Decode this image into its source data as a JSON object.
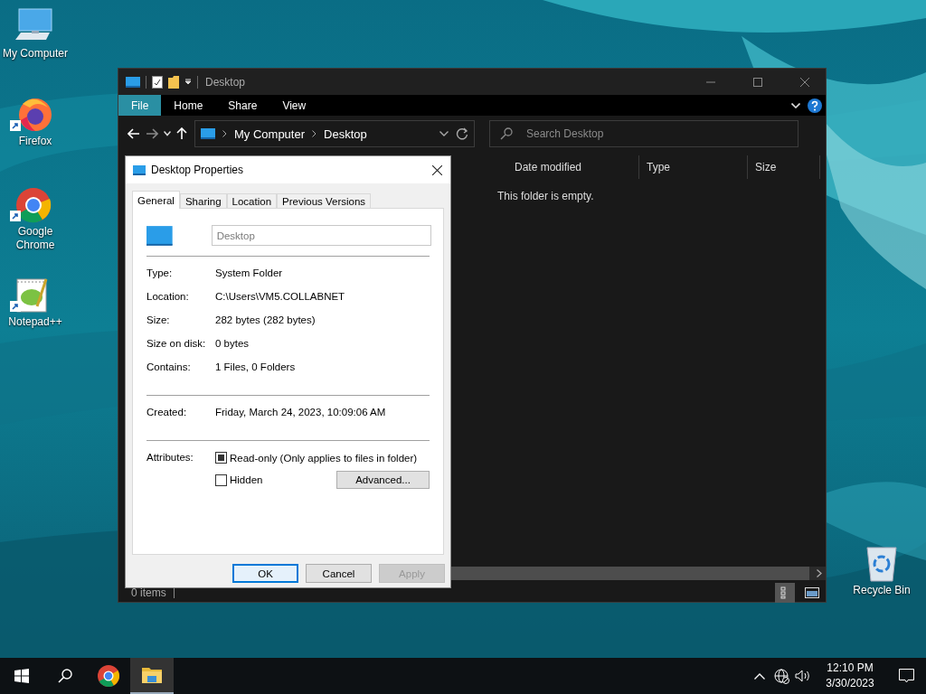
{
  "desktop_icons": [
    {
      "kind": "computer",
      "label": "My Computer",
      "shortcut": false
    },
    {
      "kind": "firefox",
      "label": "Firefox",
      "shortcut": true
    },
    {
      "kind": "chrome",
      "label": "Google Chrome",
      "shortcut": true
    },
    {
      "kind": "notepad",
      "label": "Notepad++",
      "shortcut": true
    }
  ],
  "recycle_bin": {
    "label": "Recycle Bin"
  },
  "explorer": {
    "title": "Desktop",
    "ribbon_tabs": [
      {
        "label": "File",
        "selected": true
      },
      {
        "label": "Home",
        "selected": false
      },
      {
        "label": "Share",
        "selected": false
      },
      {
        "label": "View",
        "selected": false
      }
    ],
    "breadcrumb": [
      "My Computer",
      "Desktop"
    ],
    "search": {
      "placeholder": "Search Desktop"
    },
    "columns": [
      "Date modified",
      "Type",
      "Size"
    ],
    "empty_message": "This folder is empty.",
    "status": "0 items"
  },
  "dialog": {
    "title": "Desktop Properties",
    "tabs": [
      {
        "label": "General",
        "selected": true
      },
      {
        "label": "Sharing",
        "selected": false
      },
      {
        "label": "Location",
        "selected": false
      },
      {
        "label": "Previous Versions",
        "selected": false
      }
    ],
    "name_field": {
      "value": "Desktop",
      "disabled": true
    },
    "info_groups": [
      [
        {
          "label": "Type:",
          "value": "System Folder"
        },
        {
          "label": "Location:",
          "value": "C:\\Users\\VM5.COLLABNET"
        },
        {
          "label": "Size:",
          "value": "282 bytes (282 bytes)"
        },
        {
          "label": "Size on disk:",
          "value": "0 bytes"
        },
        {
          "label": "Contains:",
          "value": "1 Files, 0 Folders"
        }
      ],
      [
        {
          "label": "Created:",
          "value": "Friday, March 24, 2023, 10:09:06 AM"
        }
      ]
    ],
    "attributes_label": "Attributes:",
    "attributes": [
      {
        "label": "Read-only (Only applies to files in folder)",
        "checked": false,
        "indeterminate": true
      },
      {
        "label": "Hidden",
        "checked": false,
        "indeterminate": false
      }
    ],
    "advanced_button": "Advanced...",
    "buttons": [
      {
        "label": "OK",
        "default": true,
        "disabled": false
      },
      {
        "label": "Cancel",
        "default": false,
        "disabled": false
      },
      {
        "label": "Apply",
        "default": false,
        "disabled": true
      }
    ]
  },
  "taskbar": {
    "apps": [
      {
        "kind": "chrome",
        "active": false
      },
      {
        "kind": "explorer",
        "active": true
      }
    ],
    "clock": {
      "time": "12:10 PM",
      "date": "3/30/2023"
    }
  }
}
